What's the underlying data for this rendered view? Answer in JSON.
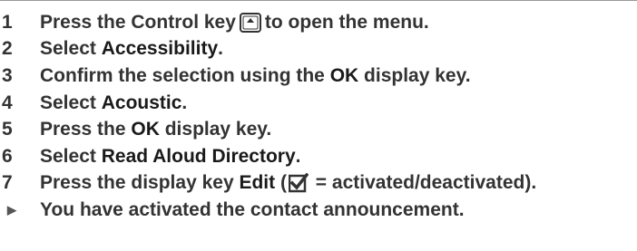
{
  "steps": [
    {
      "num": "1",
      "pre": "Press the Control key",
      "icon": "control-key-icon",
      "post": "to open the menu."
    },
    {
      "num": "2",
      "pre": "Select ",
      "kw": "Accessibility",
      "post": "."
    },
    {
      "num": "3",
      "pre": "Confirm the selection using the ",
      "kw": "OK",
      "post": " display key."
    },
    {
      "num": "4",
      "pre": "Select ",
      "kw": "Acoustic",
      "post": "."
    },
    {
      "num": "5",
      "pre": "Press the ",
      "kw": "OK",
      "post": " display key."
    },
    {
      "num": "6",
      "pre": "Select ",
      "kw": "Read Aloud Directory",
      "post": "."
    },
    {
      "num": "7",
      "pre": "Press the display key ",
      "kw": "Edit",
      "open": " (",
      "icon": "checkbox-checked-icon",
      "post": " = activated/deactivated)."
    }
  ],
  "result": {
    "marker": "▶",
    "text": "You have activated the contact announcement."
  }
}
